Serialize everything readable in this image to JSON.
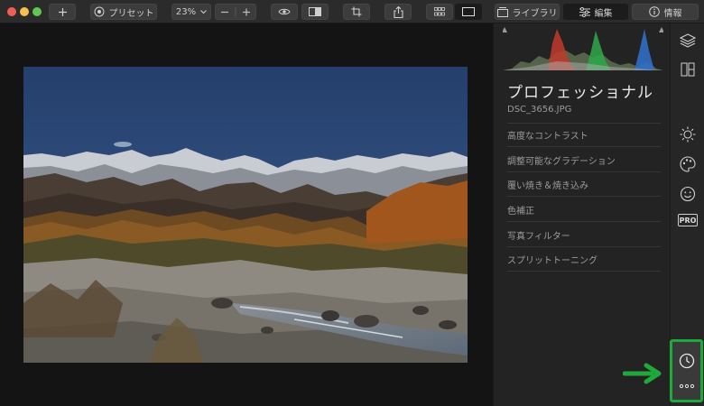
{
  "toolbar": {
    "add_icon": "plus-icon",
    "preset_label": "プリセット",
    "zoom_value": "23%",
    "library_label": "ライブラリ",
    "edit_label": "編集",
    "info_label": "情報"
  },
  "panel": {
    "title": "プロフェッショナル",
    "filename": "DSC_3656.JPG",
    "items": [
      "高度なコントラスト",
      "調整可能なグラデーション",
      "覆い焼き＆焼き込み",
      "色補正",
      "写真フィルター",
      "スプリットトーニング"
    ]
  },
  "rail": {
    "pro_label": "PRO"
  },
  "colors": {
    "highlight": "#1fa83b",
    "panel_bg": "#232323",
    "toolbar_bg": "#2b2b2b"
  }
}
